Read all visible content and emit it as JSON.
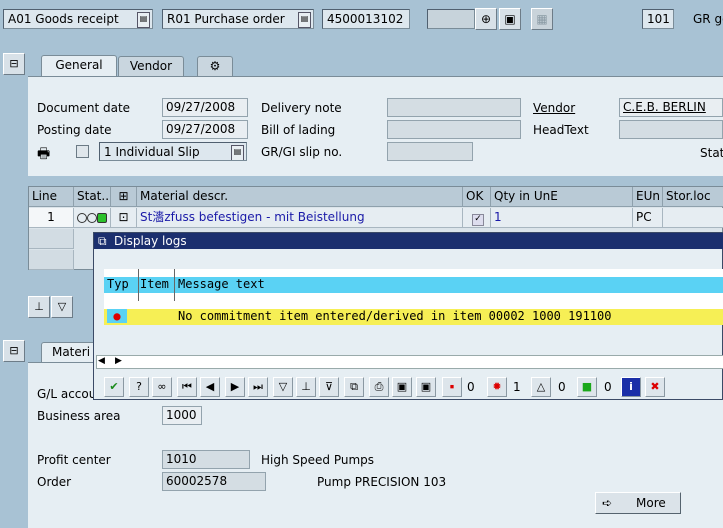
{
  "toolbar": {
    "action": "A01 Goods receipt",
    "reference": "R01 Purchase order",
    "doc_number": "4500013102",
    "movement_type": "101",
    "movement_text": "GR go"
  },
  "tabs": [
    "General",
    "Vendor"
  ],
  "header": {
    "document_date_label": "Document date",
    "document_date": "09/27/2008",
    "posting_date_label": "Posting date",
    "posting_date": "09/27/2008",
    "slip_option": "1 Individual Slip",
    "delivery_note_label": "Delivery note",
    "bill_of_lading_label": "Bill of lading",
    "slip_no_label": "GR/GI slip no.",
    "vendor_label": "Vendor",
    "vendor_value": "C.E.B. BERLIN",
    "headtext_label": "HeadText",
    "status_label": "Stat"
  },
  "table": {
    "columns": [
      "Line",
      "Stat...",
      "Material descr.",
      "OK",
      "Qty in UnE",
      "EUn",
      "Stor.loc"
    ],
    "rows": [
      {
        "line": "1",
        "material": "St瀒zfuss befestigen - mit Beistellung",
        "qty": "1",
        "unit": "PC"
      }
    ]
  },
  "popup": {
    "title": "Display logs",
    "columns": [
      "Typ",
      "Item",
      "Message text"
    ],
    "message": "No commitment item entered/derived in item 00002 1000 191100",
    "counts": {
      "stop": "0",
      "error": "1",
      "warning": "0",
      "info": "0"
    }
  },
  "lower": {
    "tab_label": "Materi",
    "gl_account_label": "G/L accou",
    "business_area_label": "Business area",
    "business_area": "1000",
    "profit_center_label": "Profit center",
    "profit_center": "1010",
    "profit_center_text": "High Speed Pumps",
    "order_label": "Order",
    "order": "60002578",
    "order_text": "Pump PRECISION 103",
    "more_label": "More"
  },
  "colors": {
    "background": "#a8c2d4",
    "popup_title": "#1b2f6e",
    "log_header": "#5ad2f4",
    "log_row": "#f6ef55",
    "link": "#1a1aa8"
  }
}
